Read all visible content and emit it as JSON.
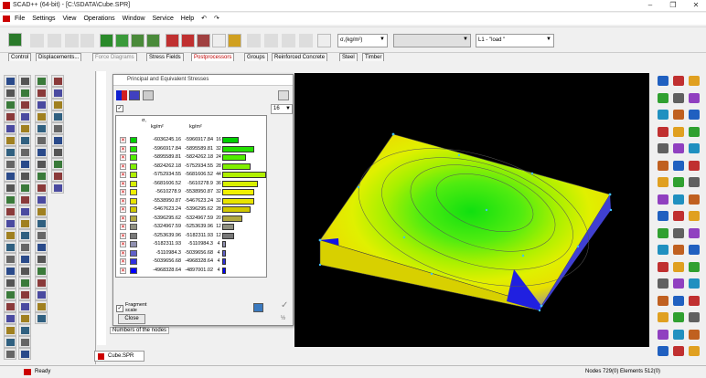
{
  "window": {
    "title": "SCAD++ (64-bit) - [C:\\SDATA\\Cube.SPR]",
    "min": "–",
    "max": "❐",
    "close": "✕"
  },
  "menu": [
    "File",
    "Settings",
    "View",
    "Operations",
    "Window",
    "Service",
    "Help"
  ],
  "menu_icons": {
    "undo": "↶",
    "redo": "↷"
  },
  "toolbar": {
    "units_combo": "σ,(kg/m²)",
    "load_combo": "L1 - \"load \""
  },
  "tabs": [
    "Control",
    "Displacements...",
    "Force Diagrams",
    "Stress Fields",
    "Postprocessors",
    "Groups",
    "Reinforced Concrete",
    "Steel",
    "Timber"
  ],
  "dialog": {
    "title": "Principal and Equivalent Stresses",
    "mode_value": "16",
    "legend_unit_label": "σ,",
    "col1_header": "kg/m²",
    "col2_header": "kg/m²",
    "fragment_label": "Fragment scale",
    "close_label": "Close",
    "rows": [
      {
        "v1": "-6036245.16",
        "v2": "-5966917.84",
        "pct": "16",
        "color": "#00d000",
        "frac": 0.38
      },
      {
        "v1": "-5966917.84",
        "v2": "-5895589.81",
        "pct": "32",
        "color": "#24e000",
        "frac": 0.73
      },
      {
        "v1": "-5895589.81",
        "v2": "-5824262.18",
        "pct": "24",
        "color": "#50ee00",
        "frac": 0.55
      },
      {
        "v1": "-5824262.18",
        "v2": "-5752934.55",
        "pct": "28",
        "color": "#80f000",
        "frac": 0.64
      },
      {
        "v1": "-5752934.55",
        "v2": "-5681606.52",
        "pct": "44",
        "color": "#b0f000",
        "frac": 1.0
      },
      {
        "v1": "-5681606.52",
        "v2": "-5610278.9",
        "pct": "36",
        "color": "#d8f000",
        "frac": 0.82
      },
      {
        "v1": "-5610278.9",
        "v2": "-5538950.87",
        "pct": "32",
        "color": "#f0f000",
        "frac": 0.73
      },
      {
        "v1": "-5538950.87",
        "v2": "-5467623.24",
        "pct": "32",
        "color": "#e8e400",
        "frac": 0.73
      },
      {
        "v1": "-5467623.24",
        "v2": "-5396295.62",
        "pct": "28",
        "color": "#d0c800",
        "frac": 0.64
      },
      {
        "v1": "-5396295.62",
        "v2": "-5324967.59",
        "pct": "20",
        "color": "#b0a840",
        "frac": 0.45
      },
      {
        "v1": "-5324967.59",
        "v2": "-5253639.96",
        "pct": "12",
        "color": "#909080",
        "frac": 0.27
      },
      {
        "v1": "-5253639.96",
        "v2": "-5182311.93",
        "pct": "12",
        "color": "#787878",
        "frac": 0.27
      },
      {
        "v1": "-5182311.93",
        "v2": "-5110984.3",
        "pct": "4",
        "color": "#9090b0",
        "frac": 0.09
      },
      {
        "v1": "-5110984.3",
        "v2": "-5039656.68",
        "pct": "4",
        "color": "#6060c8",
        "frac": 0.09
      },
      {
        "v1": "-5039656.68",
        "v2": "-4968328.64",
        "pct": "4",
        "color": "#3030e0",
        "frac": 0.09
      },
      {
        "v1": "-4968328.64",
        "v2": "-4897001.02",
        "pct": "4",
        "color": "#0000ff",
        "frac": 0.09
      }
    ]
  },
  "tree_item": "Numbers of the nodes",
  "doc_tab": "Cube.SPR",
  "status": {
    "left": "Ready",
    "right": "Nodes 729(0)  Elements 512(0)"
  }
}
